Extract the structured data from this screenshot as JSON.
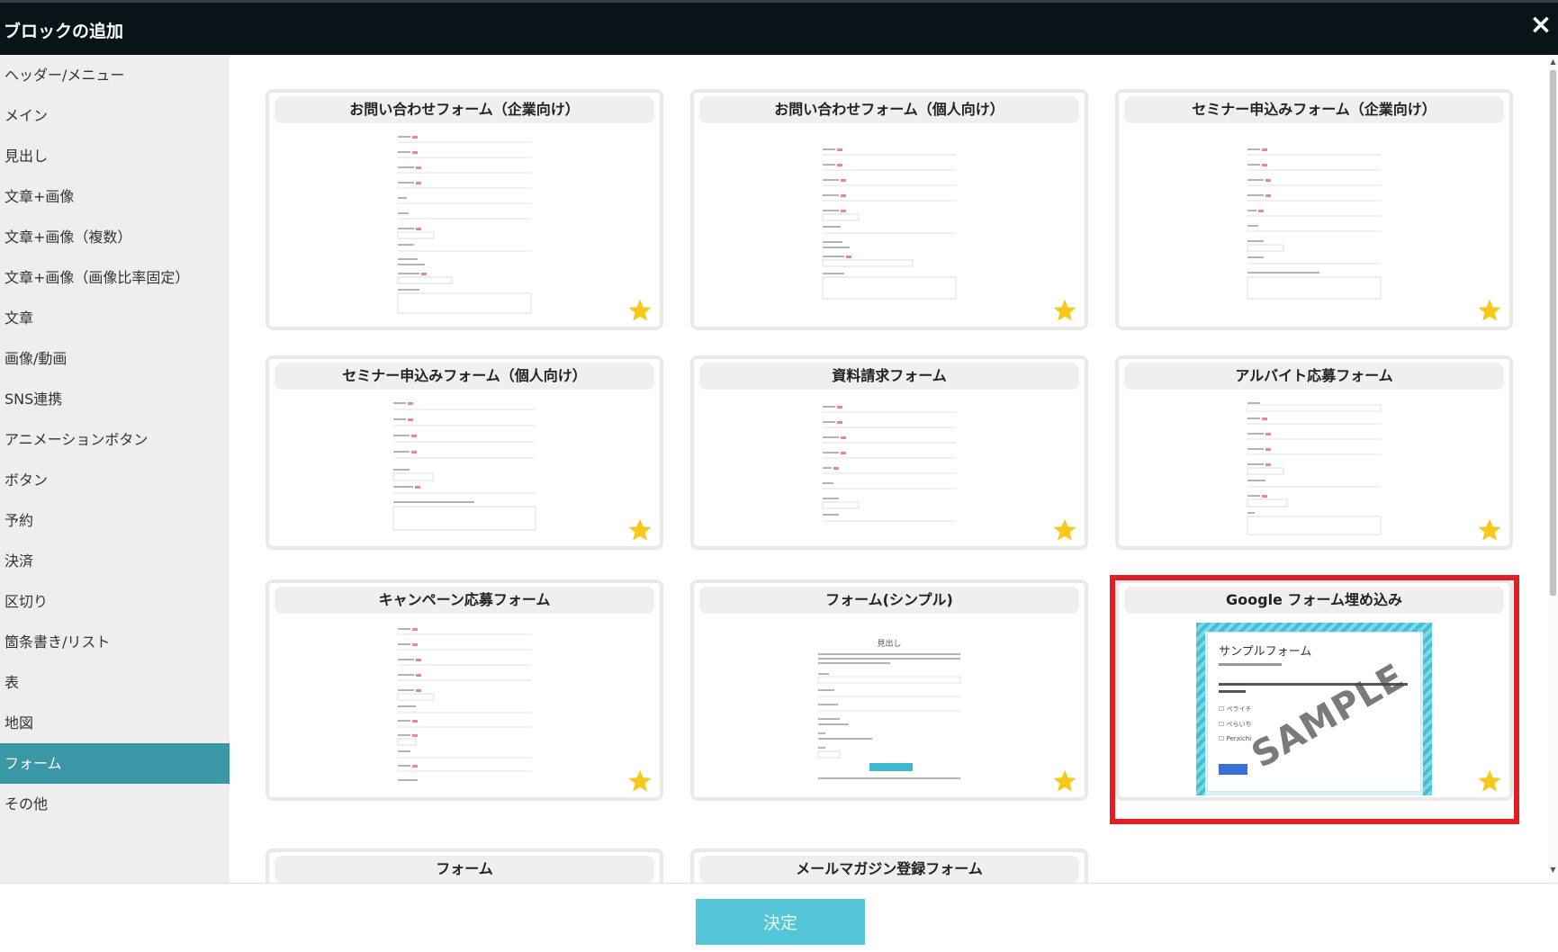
{
  "header": {
    "title": "ブロックの追加",
    "close_label": "×"
  },
  "sidebar": {
    "items": [
      {
        "label": "ヘッダー/メニュー"
      },
      {
        "label": "メイン"
      },
      {
        "label": "見出し"
      },
      {
        "label": "文章+画像"
      },
      {
        "label": "文章+画像（複数）"
      },
      {
        "label": "文章+画像（画像比率固定）"
      },
      {
        "label": "文章"
      },
      {
        "label": "画像/動画"
      },
      {
        "label": "SNS連携"
      },
      {
        "label": "アニメーションボタン"
      },
      {
        "label": "ボタン"
      },
      {
        "label": "予約"
      },
      {
        "label": "決済"
      },
      {
        "label": "区切り"
      },
      {
        "label": "箇条書き/リスト"
      },
      {
        "label": "表"
      },
      {
        "label": "地図"
      },
      {
        "label": "フォーム"
      },
      {
        "label": "その他"
      }
    ],
    "active": "フォーム"
  },
  "cards": [
    {
      "title": "お問い合わせフォーム（企業向け）"
    },
    {
      "title": "お問い合わせフォーム（個人向け）"
    },
    {
      "title": "セミナー申込みフォーム（企業向け）"
    },
    {
      "title": "セミナー申込みフォーム（個人向け）"
    },
    {
      "title": "資料請求フォーム"
    },
    {
      "title": "アルバイト応募フォーム"
    },
    {
      "title": "キャンペーン応募フォーム"
    },
    {
      "title": "フォーム(シンプル)"
    },
    {
      "title": "Google フォーム埋め込み"
    },
    {
      "title": "フォーム"
    },
    {
      "title": "メールマガジン登録フォーム"
    }
  ],
  "google_sample": {
    "form_title": "サンプルフォーム",
    "watermark": "SAMPLE",
    "options": [
      "ペライチ",
      "ぺらいち",
      "Peraichi"
    ]
  },
  "simple_form": {
    "heading": "見出し"
  },
  "footer": {
    "ok_label": "決定"
  },
  "colors": {
    "accent": "#3a97a6",
    "selected_border": "#e01e25",
    "ok_button": "#55c6d8",
    "star": "#f7c71a",
    "header_bg": "#081418"
  }
}
